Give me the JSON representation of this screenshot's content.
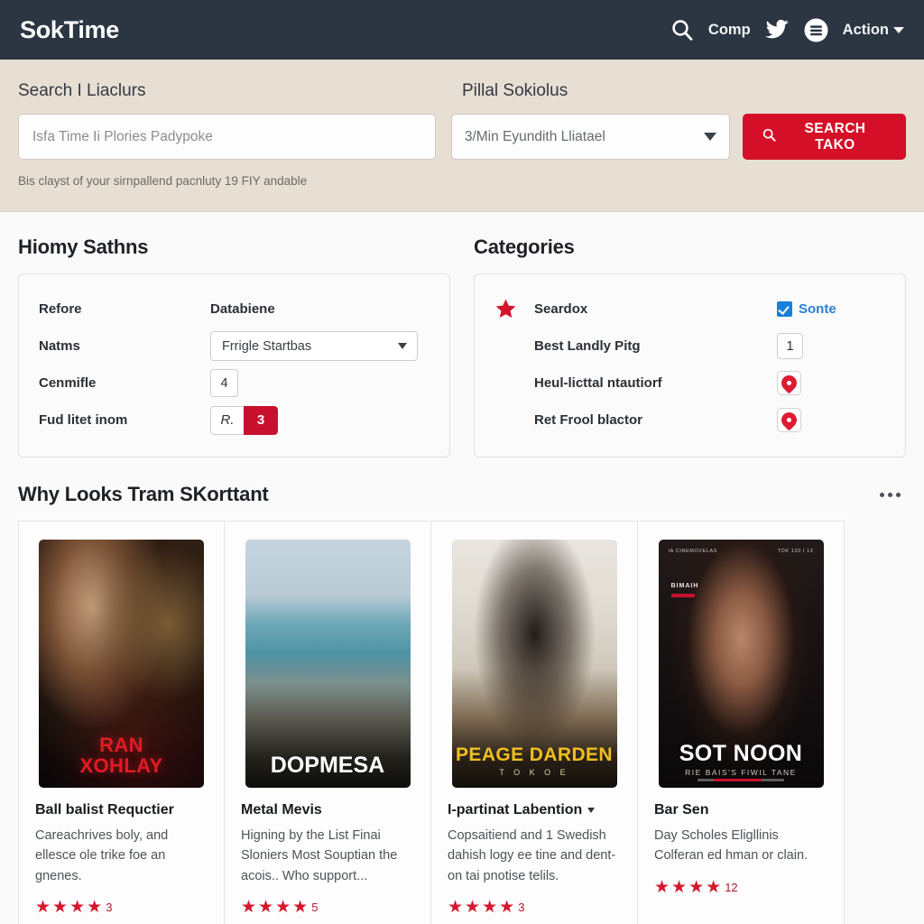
{
  "navbar": {
    "brand": "SokTime",
    "search_icon": "search-icon",
    "comp_label": "Comp",
    "twitter_icon": "twitter-icon",
    "menu_icon": "circle-menu-icon",
    "action_label": "Action",
    "caret_icon": "chevron-down-icon",
    "bg_color": "#2b3642"
  },
  "search": {
    "label_left": "Search I Liaclurs",
    "label_right": "Pillal Sokiolus",
    "input_placeholder": "Isfa Time Ii Plories Padypoke",
    "input_value": "",
    "select_value": "3/Min Eyundith Lliatael",
    "select_caret": "caret-down-icon",
    "button_icon": "search-icon",
    "button_label": "SEARCH TAKO",
    "button_color": "#d60f28",
    "hint": "Bis clayst of your sirnpallend pacnluty 19 FIY andable",
    "band_color": "#e7ded4"
  },
  "settings": {
    "title": "Hiomy Sathns",
    "rows": [
      {
        "key": "Refore",
        "value": "Databiene",
        "control": "text"
      },
      {
        "key": "Natms",
        "value": "Frrigle Startbas",
        "control": "select"
      },
      {
        "key": "Cenmifle",
        "value": "4",
        "control": "number"
      },
      {
        "key": "Fud litet inom",
        "value": "R.",
        "value2": "3",
        "control": "stepper"
      }
    ]
  },
  "categories": {
    "title": "Categories",
    "rows": [
      {
        "icon": "star-icon",
        "name": "Seardox",
        "right_type": "link",
        "right_label": "Sonte",
        "right_icon": "checkbox-checked-icon",
        "right_color": "#2a7fd4"
      },
      {
        "icon": "",
        "name": "Best Landly Pitg",
        "right_type": "number",
        "right_label": "1"
      },
      {
        "icon": "",
        "name": "Heul-licttal ntautiorf",
        "right_type": "pin",
        "right_icon": "location-pin-icon"
      },
      {
        "icon": "",
        "name": "Ret Frool blactor",
        "right_type": "pin",
        "right_icon": "location-pin-icon"
      }
    ]
  },
  "cards_section": {
    "title": "Why Looks Tram SKorttant",
    "more_icon": "more-horizontal-icon",
    "cards": [
      {
        "poster_title": "RAN",
        "poster_title2": "XOHLAY",
        "poster_subtitle": "",
        "title": "Ball balist Requctier",
        "has_caret": false,
        "desc": "Careachrives boly, and ellesce ole trike foe an gnenes.",
        "stars": 4,
        "rating": "3"
      },
      {
        "poster_title": "DOPMESA",
        "poster_title2": "",
        "poster_subtitle": "",
        "title": "Metal Mevis",
        "has_caret": false,
        "desc": "Higning by the List Finai Sloniers Most Souptian the acois.. Who support...",
        "stars": 4,
        "rating": "5"
      },
      {
        "poster_title": "PEAGE DARDEN",
        "poster_title2": "",
        "poster_subtitle": "T O K O E",
        "title": "I-partinat Labention",
        "has_caret": true,
        "desc": "Copsaitiend and 1 Swedish dahish logy ee tine and dent-on tai pnotise telils.",
        "stars": 4,
        "rating": "3"
      },
      {
        "poster_title": "SOT NOON",
        "poster_title2": "",
        "poster_subtitle": "RIE BAIS'S FIWIL TANE",
        "poster_tag": "BIMAIH",
        "poster_corner_left": "IA CINEMOVELAS",
        "poster_corner_right": "TOK 120 I 12",
        "title": "Bar Sen",
        "has_caret": false,
        "desc": "Day Scholes Eligllinis Colferan ed hman or clain.",
        "stars": 4,
        "rating": "12"
      }
    ]
  }
}
